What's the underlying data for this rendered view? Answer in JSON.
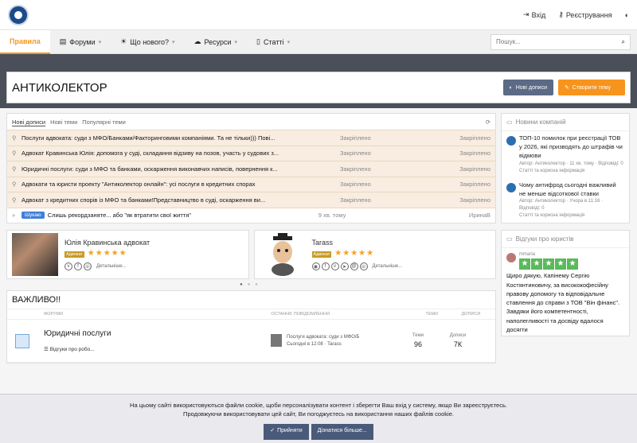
{
  "header": {
    "login_label": "Вхід",
    "register_label": "Реєстрування"
  },
  "nav": {
    "tabs": [
      {
        "label": "Правила"
      },
      {
        "label": "Форуми"
      },
      {
        "label": "Що нового?"
      },
      {
        "label": "Ресурси"
      },
      {
        "label": "Статті"
      }
    ],
    "search_placeholder": "Пошук..."
  },
  "page": {
    "title": "АНТИКОЛЕКТОР",
    "new_posts_button": "Нові дописи",
    "create_topic_button": "Створити тему"
  },
  "threads": {
    "tabs": [
      "Нові дописи",
      "Нові теми",
      "Популярні теми"
    ],
    "items": [
      {
        "title": "Послуги адвоката: суди з МФО/Банками/Факторинговими компаніями. Та не тільки))) Пові...",
        "meta": "Закріплено",
        "last": "Закріплено"
      },
      {
        "title": "Адвокат Кравинська Юлія: допомога у суді, складання відзиву на позов, участь у судових з...",
        "meta": "Закріплено",
        "last": "Закріплено"
      },
      {
        "title": "Юридичні послуги: суди з МФО та банками, оскарження виконавчих написів, повернення к...",
        "meta": "Закріплено",
        "last": "Закріплено"
      },
      {
        "title": "Адвокати та юристи проекту \"Антиколектор онлайн\": усі послуги в кредитних спорах",
        "meta": "Закріплено",
        "last": "Закріплено"
      },
      {
        "title": "Адвокат з кредитних спорів із МФО та банками!Представництво в суді, оскарження ви...",
        "meta": "Закріплено",
        "last": "Закріплено"
      },
      {
        "prefix": "Шукаю",
        "title": "Слишь рекордзаняте... або \"як втратити свої життя\"",
        "meta": "9 хв. тому",
        "last": "ИринаВ"
      }
    ]
  },
  "experts": [
    {
      "name": "Юлія Кравинська адвокат",
      "role": "Адвокат",
      "details": "Детальніше..."
    },
    {
      "name": "Tarass",
      "role": "Адвокат",
      "details": "Детальніше..."
    }
  ],
  "important": {
    "title": "ВАЖЛИВО!!",
    "col_forums": "ФОРУМИ",
    "col_last": "ОСТАННЄ ПОВІДОМЛЕННЯ",
    "col_topics": "ТЕМИ",
    "col_posts": "ДОПИСИ",
    "forum": {
      "title": "Юридичні послуги",
      "sub": "Відгуки про робо...",
      "last_title": "Послуги адвоката: суди з МФО/Б",
      "last_meta": "Сьогодні в 12:08 · Tarass",
      "topics_label": "Теми",
      "topics": "96",
      "posts_label": "Дописи",
      "posts": "7К"
    }
  },
  "sidebar": {
    "news_title": "Новини компаній",
    "news": [
      {
        "title": "ТОП-10 помилок при реєстрації ТОВ у 2026, які призводять до штрафів чи відмови",
        "author": "Автор: Антиколектор · 11 хв. тому · Відповіді: 0",
        "cat": "Статті та корисна інформація"
      },
      {
        "title": "Чому антифрод сьогодні важливий не менше відсоткової ставки",
        "author": "Автор: Антиколектор · Учора в 11:16 · Відповіді: 0",
        "cat": "Статті та корисна інформація"
      }
    ],
    "reviews_title": "Відгуки про юристів",
    "review_author": "mmaria",
    "review_text": "Щиро дякую, Капінему Сергію Костянтиновичу, за висококофесійну правову допомогу та відповідальне ставлення до справи з ТОВ \"Він фінанс\". Завдяки його компетентності, наполегливості та досвіду вдалося досягти"
  },
  "cookie": {
    "line1": "На цьому сайті використовуються файли cookie, щоби персоналізувати контент і зберегти Ваш вхід у систему, якщо Ви зареєструєтесь.",
    "line2": "Продовжуючи використовувати цей сайт, Ви погоджуєтесь на використання наших файлів cookie.",
    "accept": "Прийняти",
    "learn_more": "Дізнатися більше..."
  },
  "colors": {
    "accent": "#f7941d",
    "band": "#4a4f5a",
    "primary_button": "#5b6a85"
  }
}
